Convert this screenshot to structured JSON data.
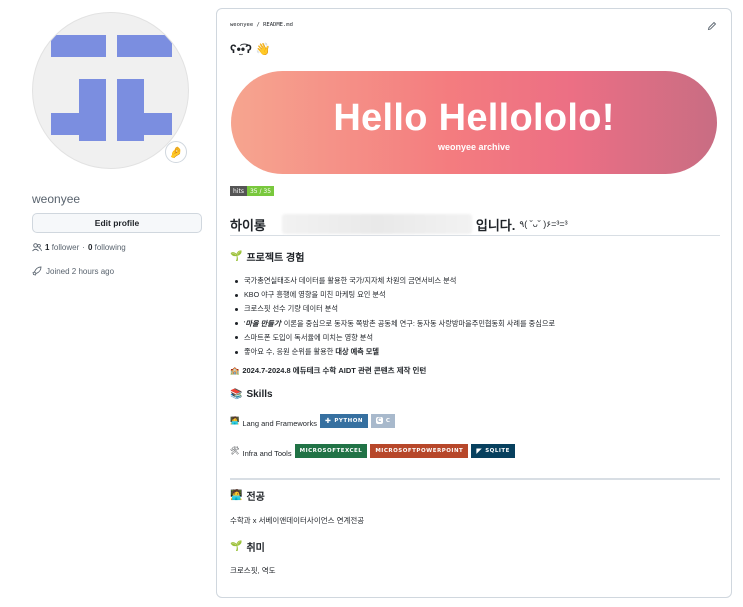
{
  "profile": {
    "username": "weonyee",
    "edit_label": "Edit profile",
    "followers_count": "1",
    "followers_label": "follower",
    "separator": "·",
    "following_count": "0",
    "following_label": "following",
    "joined": "Joined 2 hours ago",
    "status_emoji": "🤌"
  },
  "readme": {
    "path": "weonyee / README.md",
    "greeting": "ʕ•̫͡•ʔ",
    "greeting_emoji": "👋",
    "banner_title": "Hello Hellololo!",
    "banner_subtitle": "weonyee archive",
    "hits_label": "hits",
    "hits_value": "35 / 35",
    "intro_prefix": "하이롱",
    "intro_suffix": "입니다.",
    "intro_kaomoji": "٩( ˘ᴗ˘ )۶=³=³",
    "project_title": "프로젝트 경험",
    "project_emoji": "🌱",
    "projects": [
      "국가총연실태조사 데이터를 활용한 국가/지자체 차원의 금연서비스 분석",
      "KBO 야구 흥행에 영향을 미친 마케팅 요인 분석",
      "크로스핏 선수 기량 데이터 분석",
      "'마을 만들기' 이론을 중심으로 동자동 쪽방촌 공동체 연구: 동자동 사랑방마을주민협동회 사례를 중심으로",
      "스마트폰 도입이 독서율에 미치는 영향 분석",
      "좋아요 수, 응원 순위를 활용한 대상 예측 모델"
    ],
    "projects_bold_fragments": {
      "3": "마을 만들기",
      "5": "대상 예측 모델"
    },
    "intern_emoji": "🏫",
    "intern_text": "2024.7-2024.8 에듀테크 수학 AIDT 관련 콘텐츠 제작 인턴",
    "skills_emoji": "📚",
    "skills_title": "Skills",
    "lang_emoji": "🧑‍💻",
    "lang_label": "Lang and Frameworks",
    "lang_badges": [
      {
        "label": "PYTHON",
        "color": "#3670a0"
      },
      {
        "label": "C",
        "color": "#a8b9cc"
      }
    ],
    "infra_emoji": "🛠",
    "infra_label": "Infra and Tools",
    "infra_badges": [
      {
        "label": "MICROSOFTEXCEL",
        "color": "#217346"
      },
      {
        "label": "MICROSOFTPOWERPOINT",
        "color": "#b7472a"
      },
      {
        "label": "SQLITE",
        "color": "#07405e"
      }
    ],
    "major_emoji": "🧑‍💻",
    "major_title": "전공",
    "major_text": "수학과 x 서베이앤데이터사이언스 연계전공",
    "hobby_emoji": "🌱",
    "hobby_title": "취미",
    "hobby_text": "크로스핏, 역도"
  },
  "colors": {
    "avatar_pattern": "#7b8ee0",
    "banner_start": "#f6a58f",
    "banner_end": "#c86d83"
  }
}
